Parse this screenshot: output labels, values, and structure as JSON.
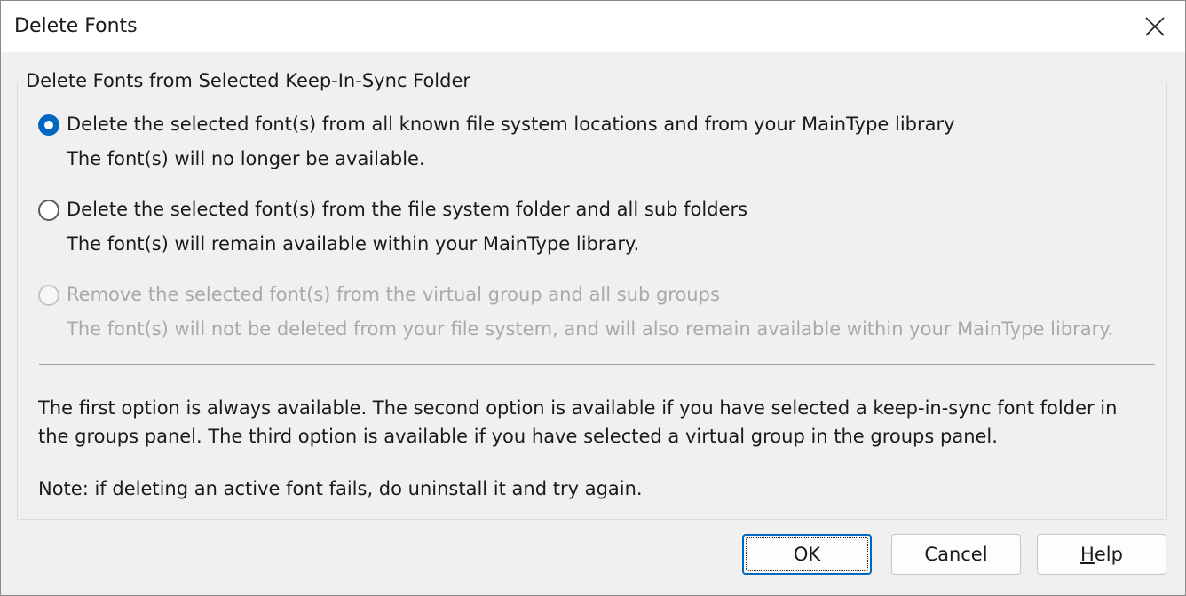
{
  "window": {
    "title": "Delete Fonts",
    "close_icon": "close-icon"
  },
  "group": {
    "legend": "Delete Fonts from Selected Keep-In-Sync Folder",
    "options": [
      {
        "label": "Delete the selected font(s) from all known file system locations and from your MainType library",
        "description": "The font(s) will no longer be available.",
        "checked": true,
        "enabled": true
      },
      {
        "label": "Delete the selected font(s) from the file system folder and all sub folders",
        "description": "The font(s) will remain available within your MainType library.",
        "checked": false,
        "enabled": true
      },
      {
        "label": "Remove the selected font(s) from the virtual group and all sub groups",
        "description": "The font(s) will not be deleted from your file system, and will also remain available within your MainType library.",
        "checked": false,
        "enabled": false
      }
    ],
    "info": "The first option is always available. The second option is available if you have selected a keep-in-sync font folder in the groups panel. The third option is available if you have selected a virtual group in the groups panel.",
    "note": "Note: if deleting an active font fails, do uninstall it and try again."
  },
  "buttons": {
    "ok": "OK",
    "cancel": "Cancel",
    "help_mnemonic": "H",
    "help_rest": "elp"
  },
  "colors": {
    "accent": "#0067c0",
    "disabled_text": "#a9a9a9"
  }
}
